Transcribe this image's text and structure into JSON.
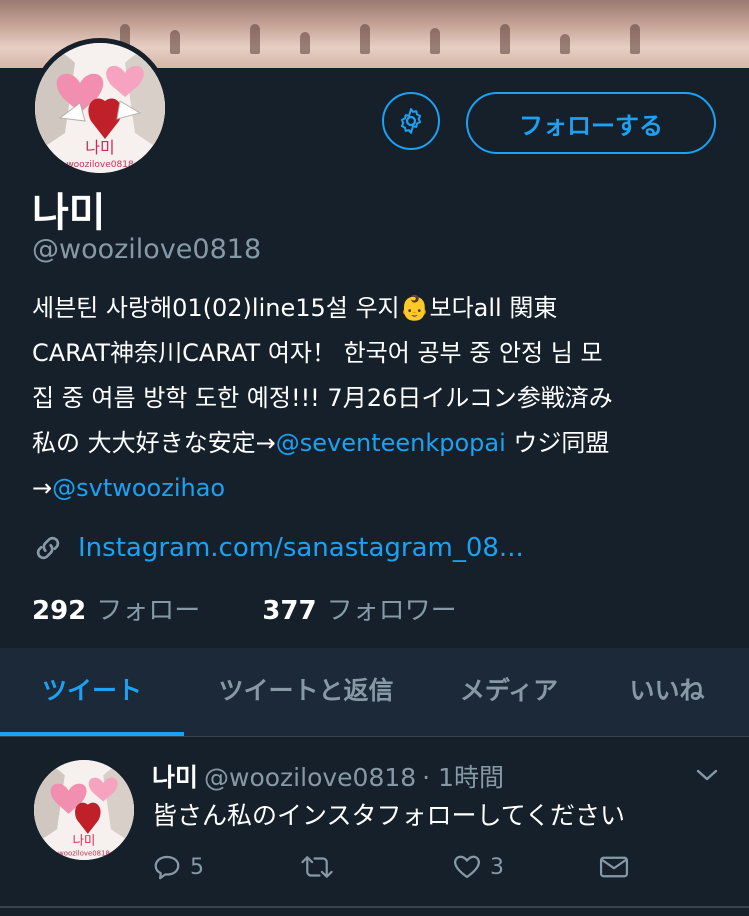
{
  "profile": {
    "display_name": "나미",
    "handle": "@woozilove0818",
    "bio_lines": [
      "세븐틴 사랑해01(02)line15설 우지👶보다all 関東",
      "CARAT神奈川CARAT 여자！ 한국어 공부 중 안정 님 모",
      "집 중 여름 방학 도한 예정!!! 7月26日イルコン参戦済み"
    ],
    "bio_line4_text": "私の 大大好きな安定→",
    "bio_line4_mention": "@seventeenkpopai",
    "bio_line4_suffix": " ウジ同盟",
    "bio_line5_arrow": "→",
    "bio_line5_mention": "@svtwoozihao",
    "website": "Instagram.com/sanastagram_08...",
    "avatar_text": "나미",
    "avatar_subtext": "woozilove0818",
    "following_count": "292",
    "following_label": "フォロー",
    "followers_count": "377",
    "followers_label": "フォロワー"
  },
  "buttons": {
    "follow_label": "フォローする",
    "settings_icon": "gear-icon"
  },
  "tabs": [
    {
      "label": "ツイート",
      "active": true
    },
    {
      "label": "ツイートと返信",
      "active": false
    },
    {
      "label": "メディア",
      "active": false
    },
    {
      "label": "いいね",
      "active": false
    }
  ],
  "tweet": {
    "author_name": "나미",
    "author_handle": "@woozilove0818",
    "time": "· 1時間",
    "text": "皆さん私のインスタフォローしてください",
    "reply_count": "5",
    "retweet_count": "",
    "like_count": "3"
  },
  "colors": {
    "background": "#15202b",
    "accent": "#1da1f2",
    "secondary_text": "#8899a6"
  }
}
